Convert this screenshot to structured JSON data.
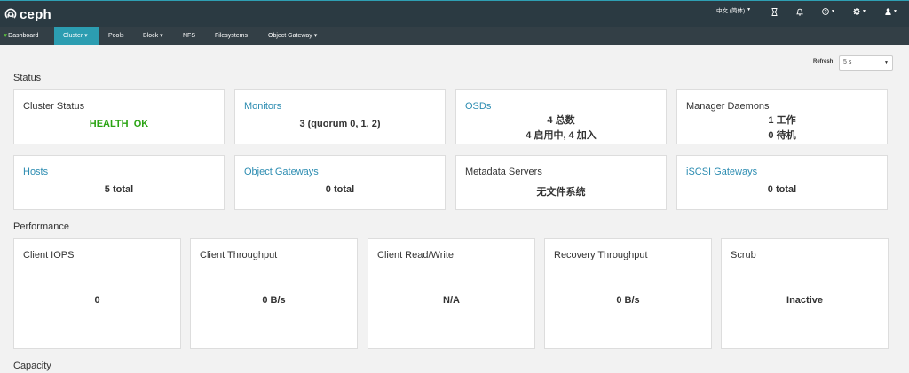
{
  "header": {
    "logo_text": "ceph",
    "language": {
      "label": "中文 (简体)",
      "icon": "caret-down-icon"
    },
    "task_icon": "hourglass-icon",
    "notification_icon": "bell-icon",
    "help_icon": "question-circle-icon",
    "settings_icon": "gear-icon",
    "user_icon": "user-icon"
  },
  "nav": {
    "items": [
      {
        "label": "Dashboard",
        "icon": "heart-icon"
      },
      {
        "label": "Cluster",
        "caret": "▾",
        "active": true
      },
      {
        "label": "Pools"
      },
      {
        "label": "Block",
        "caret": "▾"
      },
      {
        "label": "NFS"
      },
      {
        "label": "Filesystems"
      },
      {
        "label": "Object Gateway",
        "caret": "▾"
      }
    ]
  },
  "refresh": {
    "label": "Refresh",
    "value": "5 s"
  },
  "sections": {
    "status": "Status",
    "performance": "Performance",
    "capacity": "Capacity"
  },
  "status_cards": [
    {
      "title": "Cluster Status",
      "link": false,
      "lines": [
        "HEALTH_OK"
      ],
      "status_color": "#2ba414"
    },
    {
      "title": "Monitors",
      "link": true,
      "lines": [
        "3 (quorum 0, 1, 2)"
      ]
    },
    {
      "title": "OSDs",
      "link": true,
      "lines": [
        "4 总数",
        "4 启用中, 4 加入"
      ]
    },
    {
      "title": "Manager Daemons",
      "link": false,
      "lines": [
        "1 工作",
        "0 待机"
      ]
    },
    {
      "title": "Hosts",
      "link": true,
      "lines": [
        "5 total"
      ]
    },
    {
      "title": "Object Gateways",
      "link": true,
      "lines": [
        "0 total"
      ]
    },
    {
      "title": "Metadata Servers",
      "link": false,
      "lines": [
        "无文件系统"
      ]
    },
    {
      "title": "iSCSI Gateways",
      "link": true,
      "lines": [
        "0 total"
      ]
    }
  ],
  "performance_cards": [
    {
      "title": "Client IOPS",
      "value": "0"
    },
    {
      "title": "Client Throughput",
      "value": "0 B/s"
    },
    {
      "title": "Client Read/Write",
      "value": "N/A"
    },
    {
      "title": "Recovery Throughput",
      "value": "0 B/s"
    },
    {
      "title": "Scrub",
      "value": "Inactive"
    }
  ],
  "colors": {
    "header_bg": "#2b3a42",
    "nav_bg": "#333f46",
    "accent": "#2c9db1",
    "link": "#2c8cb1",
    "health_ok": "#2ba414"
  }
}
